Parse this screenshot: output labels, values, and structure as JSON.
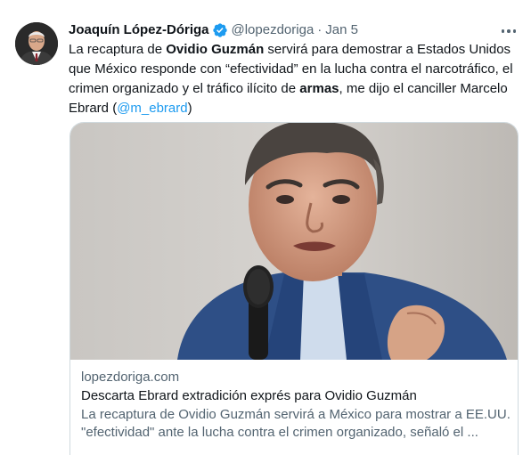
{
  "tweet": {
    "author": {
      "display_name": "Joaquín López-Dóriga",
      "handle": "@lopezdoriga",
      "verified_icon": "verified-badge-icon",
      "avatar": "author-avatar"
    },
    "separator": "·",
    "date": "Jan 5",
    "more_icon": "more-options-icon",
    "text": {
      "part1": "La recaptura de ",
      "bold1": "Ovidio Guzmán",
      "part2": " servirá para demostrar a Estados Unidos que México responde con “efectividad” en la lucha contra el narcotráfico, el crimen organizado y el tráfico ilícito de ",
      "bold2": "armas",
      "part3": ", me dijo el canciller Marcelo Ebrard (",
      "mention": "@m_ebrard",
      "part4": ")"
    },
    "link_card": {
      "domain": "lopezdoriga.com",
      "title": "Descarta Ebrard extradición exprés para Ovidio Guzmán",
      "description_line1": "La recaptura de Ovidio Guzmán servirá a México para mostrar a EE.UU.",
      "description_line2": "\"efectividad\" ante la lucha contra el crimen organizado, señaló el ..."
    }
  },
  "colors": {
    "accent": "#1d9bf0",
    "text_primary": "#0f1419",
    "text_secondary": "#536471",
    "border": "#cfd9de"
  }
}
